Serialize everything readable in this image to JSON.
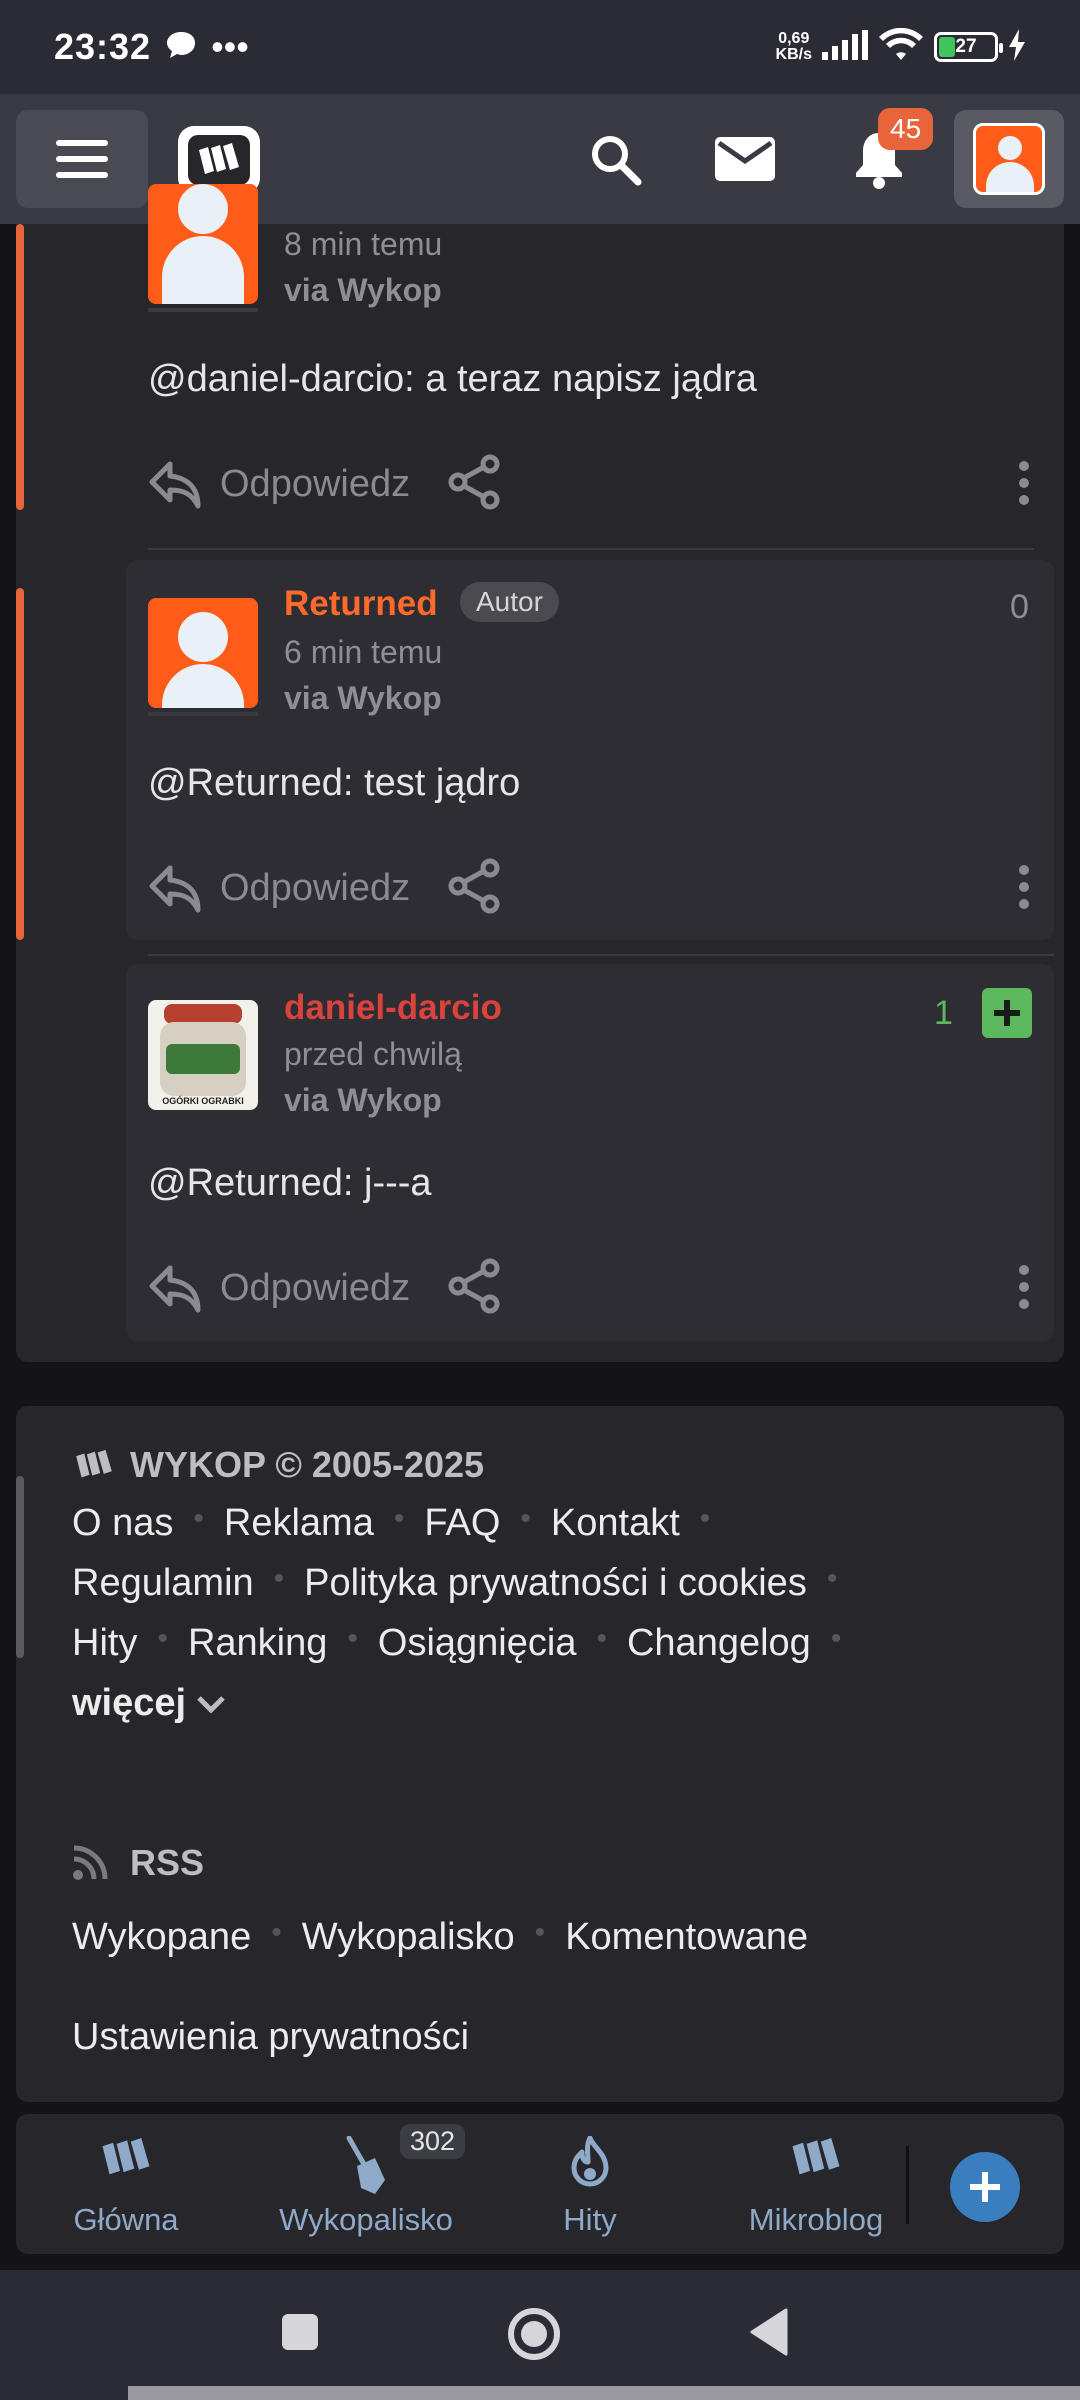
{
  "status_bar": {
    "time": "23:32",
    "net_speed_top": "0,69",
    "net_speed_bottom": "KB/s",
    "battery": "27"
  },
  "app_bar": {
    "notifications_count": "45",
    "icons": [
      "menu-icon",
      "wykop-logo",
      "search-icon",
      "mail-icon",
      "bell-icon",
      "user-avatar"
    ]
  },
  "comments": [
    {
      "time": "8 min temu",
      "via": "via Wykop",
      "text": "@daniel-darcio: a teraz napisz jądra",
      "reply": "Odpowiedz"
    },
    {
      "author": "Returned",
      "badge": "Autor",
      "votes": "0",
      "time": "6 min temu",
      "via": "via Wykop",
      "text": "@Returned: test jądro",
      "reply": "Odpowiedz"
    },
    {
      "author": "daniel-darcio",
      "votes": "1",
      "time": "przed chwilą",
      "via": "via Wykop",
      "text": "@Returned: j---a",
      "reply": "Odpowiedz",
      "avatar_caption": "OGÓRKI OGRABKI"
    }
  ],
  "footer": {
    "title": "WYKOP © 2005-2025",
    "links_row1": [
      "O nas",
      "Reklama",
      "FAQ",
      "Kontakt"
    ],
    "links_row2": [
      "Regulamin",
      "Polityka prywatności i cookies"
    ],
    "links_row3": [
      "Hity",
      "Ranking",
      "Osiągnięcia",
      "Changelog"
    ],
    "more": "więcej",
    "rss_title": "RSS",
    "rss_links": [
      "Wykopane",
      "Wykopalisko",
      "Komentowane"
    ],
    "privacy": "Ustawienia prywatności"
  },
  "bottom_nav": {
    "items": [
      "Główna",
      "Wykopalisko",
      "Hity",
      "Mikroblog"
    ],
    "wykopalisko_badge": "302"
  },
  "colors": {
    "accent": "#e8643a",
    "author_orange": "#ff6a2b",
    "user_red": "#d9423d",
    "vote_green": "#5cb85c",
    "nav_blue": "#8fa9c9"
  }
}
